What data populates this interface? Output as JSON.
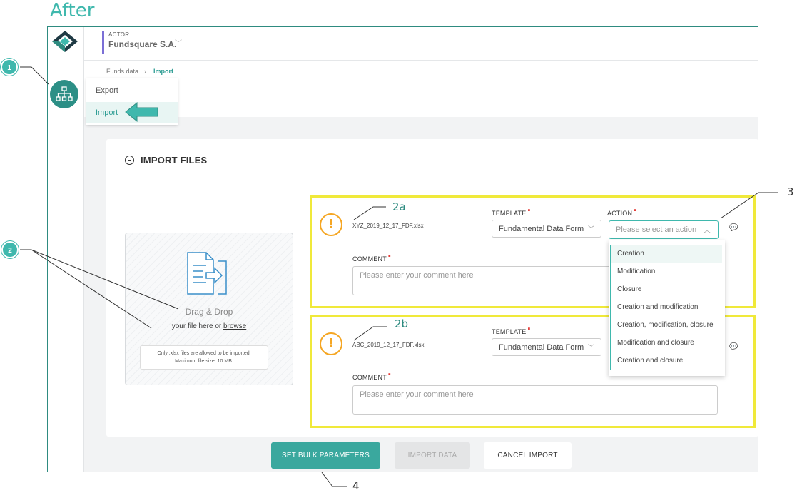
{
  "heading": "After",
  "header": {
    "actor_label": "ACTOR",
    "actor_name": "Fundsquare S.A."
  },
  "breadcrumb": {
    "parent": "Funds data",
    "current": "Import"
  },
  "nav_menu": {
    "items": [
      {
        "label": "Export",
        "selected": false
      },
      {
        "label": "Import",
        "selected": true
      }
    ]
  },
  "import_panel": {
    "title": "IMPORT FILES",
    "dropzone": {
      "title": "Drag & Drop",
      "subtitle_prefix": "your file here or",
      "browse_link": "browse",
      "note_line1": "Only .xlsx files are allowed to be imported.",
      "note_line2": "Maximum file size: 10 MB."
    },
    "files": [
      {
        "filename": "XYZ_2019_12_17_FDF.xlsx",
        "template_label": "TEMPLATE",
        "template_value": "Fundamental Data Form",
        "action_label": "ACTION",
        "action_placeholder": "Please select an action",
        "comment_label": "COMMENT",
        "comment_placeholder": "Please enter your comment here"
      },
      {
        "filename": "ABC_2019_12_17_FDF.xlsx",
        "template_label": "TEMPLATE",
        "template_value": "Fundamental Data Form",
        "comment_label": "COMMENT",
        "comment_placeholder": "Please enter your comment here"
      }
    ],
    "action_options": [
      "Creation",
      "Modification",
      "Closure",
      "Creation and modification",
      "Creation, modification, closure",
      "Modification and closure",
      "Creation and closure"
    ]
  },
  "footer_buttons": {
    "bulk": "SET BULK PARAMETERS",
    "import": "IMPORT DATA",
    "cancel": "CANCEL IMPORT"
  },
  "annotations": {
    "c1": "1",
    "c2": "2",
    "a2a": "2a",
    "a2b": "2b",
    "a3": "3",
    "a4": "4"
  },
  "colors": {
    "accent": "#3fb8ad",
    "highlight_border": "#f0e93a",
    "warning": "#f5a623",
    "required": "#e53935",
    "actor_bar": "#7b6fd6"
  },
  "icons": [
    "logo-icon",
    "org-chart-icon",
    "arrow-left-icon",
    "minus-circle-icon",
    "file-import-icon",
    "warning-icon",
    "chevron-down-icon",
    "comment-icon"
  ]
}
